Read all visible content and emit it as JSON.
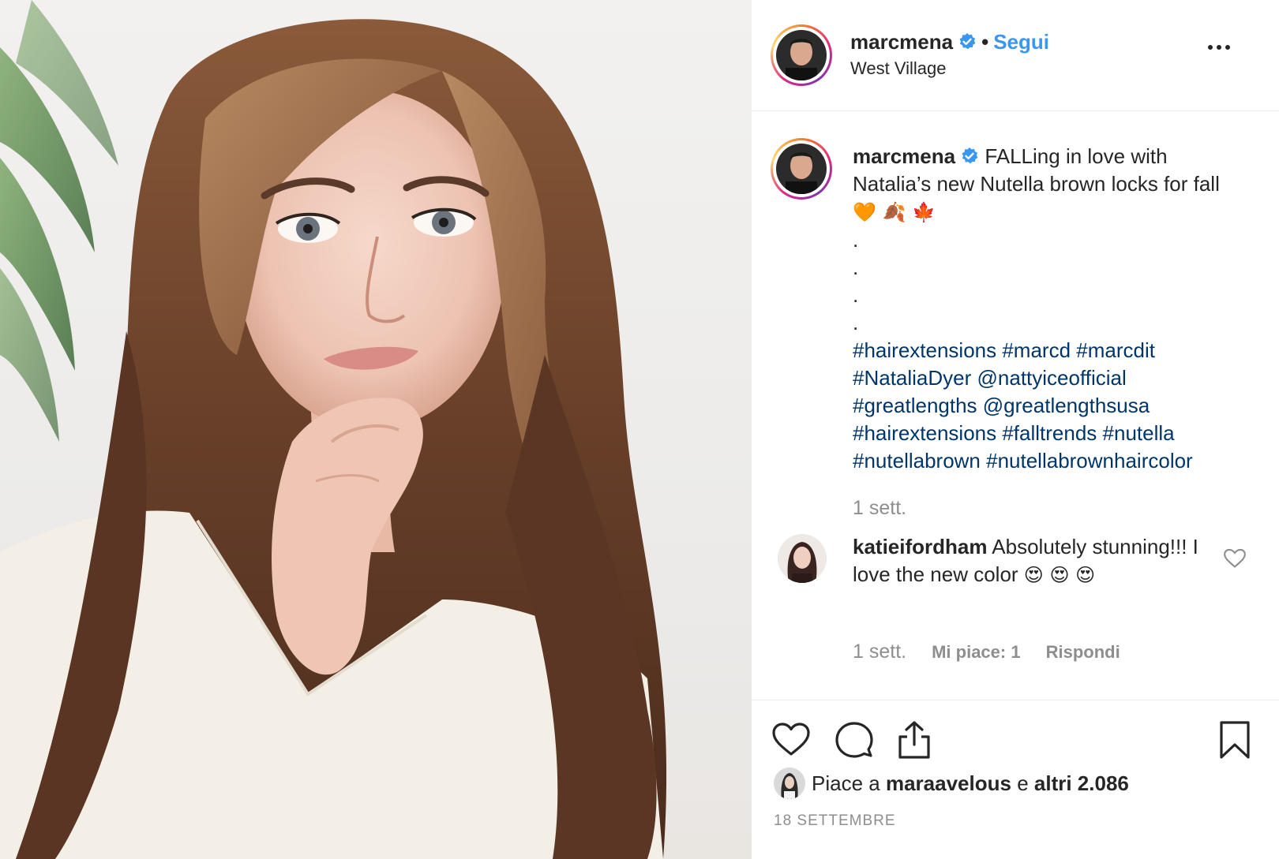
{
  "post": {
    "username": "marcmena",
    "separator": "•",
    "follow_label": "Segui",
    "location": "West Village",
    "more_icon": "more-options-icon"
  },
  "caption": {
    "username": "marcmena",
    "text": "FALLing in love with Natalia’s new Nutella brown locks for fall",
    "emojis": "🧡 🍂 🍁",
    "dots": [
      ".",
      ".",
      ".",
      "."
    ],
    "tags_line1": "#hairextensions #marcd #marcdit",
    "tags_line2": "#NataliaDyer @nattyiceofficial",
    "tags_line3": "#greatlengths @greatlengthsusa",
    "tags_line4": "#hairextensions #falltrends #nutella",
    "tags_line5": "#nutellabrown #nutellabrownhaircolor",
    "time": "1 sett."
  },
  "comment": {
    "username": "katieifordham",
    "text": "Absolutely stunning!!! I love the new color",
    "emojis": "😍 😍 😍",
    "time": "1 sett.",
    "likes_label": "Mi piace: 1",
    "reply_label": "Rispondi"
  },
  "actions": {
    "icons": [
      "heart-icon",
      "comment-icon",
      "share-icon",
      "bookmark-icon"
    ]
  },
  "likes": {
    "prefix": "Piace a",
    "user": "maraavelous",
    "joiner": "e",
    "others": "altri 2.086"
  },
  "date": "18 SETTEMBRE",
  "colors": {
    "link_blue": "#3897f0",
    "hashtag": "#003569",
    "muted": "#8e8e8e",
    "text": "#262626"
  }
}
